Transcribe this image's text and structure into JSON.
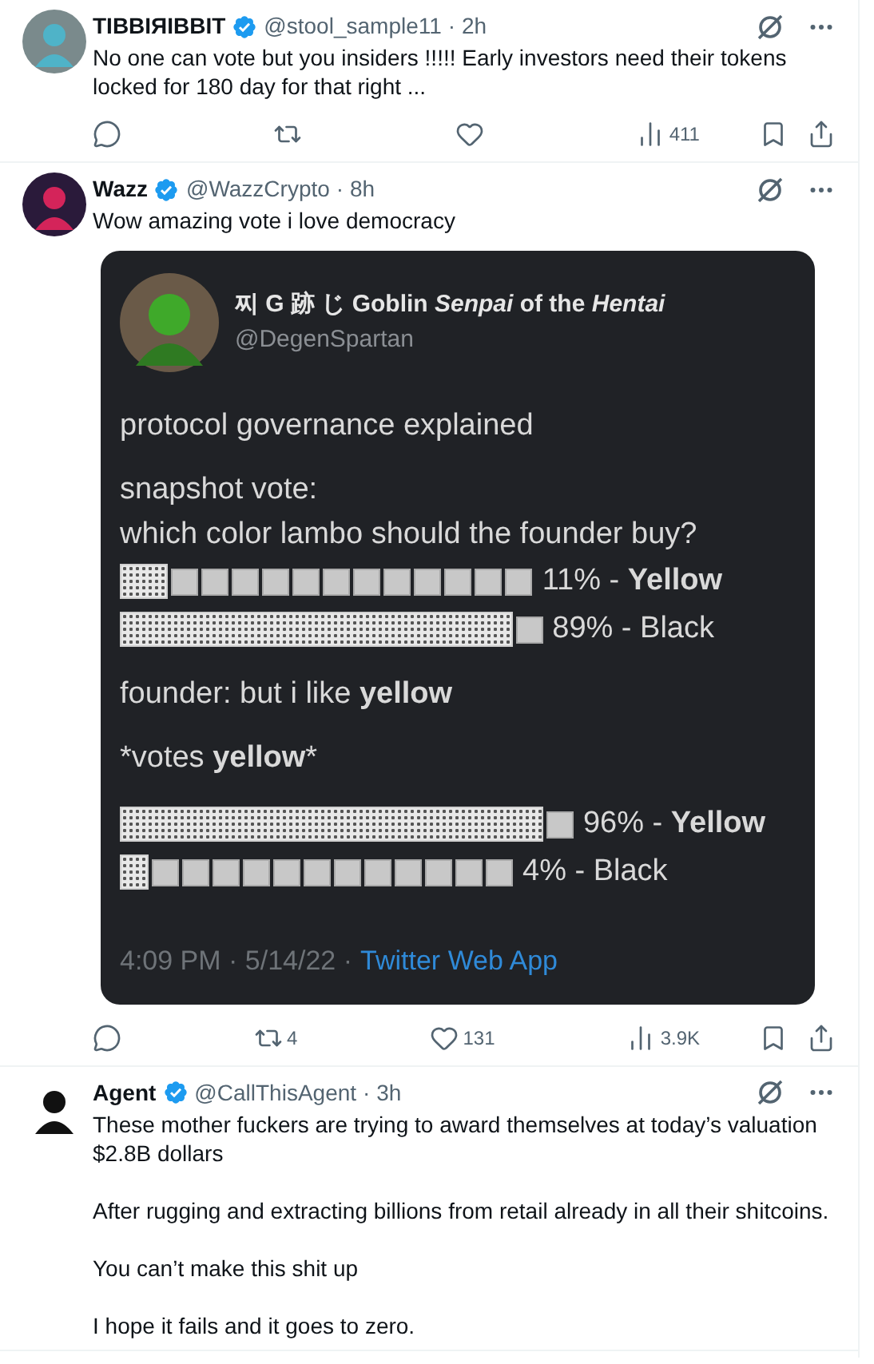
{
  "tweets": [
    {
      "author": {
        "name": "TIBBIЯIBBIT",
        "verified": true,
        "handle": "@stool_sample11",
        "time": "· 2h"
      },
      "body": [
        "No one can vote but you insiders !!!!! Early investors need their tokens locked for 180 day for that right ..."
      ],
      "actions": [
        {
          "kind": "reply"
        },
        {
          "kind": "repost"
        },
        {
          "kind": "like"
        },
        {
          "kind": "views",
          "count": "411"
        },
        {
          "kind": "bookmark"
        },
        {
          "kind": "share"
        }
      ]
    },
    {
      "author": {
        "name": "Wazz",
        "verified": true,
        "handle": "@WazzCrypto",
        "time": "· 8h"
      },
      "body": [
        "Wow amazing vote i love democracy"
      ],
      "quote": {
        "author": {
          "name": "찌 G 跡 じ Goblin *Senpai* of the *Hentai*",
          "handle": "@DegenSpartan"
        },
        "paragraphs": [
          [
            {
              "kind": "text",
              "text": "protocol governance explained"
            }
          ],
          [
            {
              "kind": "text",
              "text": "snapshot vote:"
            },
            {
              "kind": "text",
              "text": "which color lambo should the founder buy?"
            },
            {
              "kind": "poll",
              "level": 0.11,
              "label": "11% - **Yellow**"
            },
            {
              "kind": "poll",
              "level": 0.89,
              "label": "89% - Black"
            }
          ],
          [
            {
              "kind": "text",
              "text": "founder: but i like **yellow**"
            }
          ],
          [
            {
              "kind": "text",
              "text": "*votes **yellow***"
            }
          ],
          [
            {
              "kind": "poll",
              "level": 0.96,
              "label": "96% - **Yellow**"
            },
            {
              "kind": "poll",
              "level": 0.04,
              "label": "4% - Black"
            }
          ]
        ],
        "timestamp": "4:09 PM · 5/14/22 ·",
        "source": "Twitter Web App"
      },
      "actions": [
        {
          "kind": "reply"
        },
        {
          "kind": "repost",
          "count": "4"
        },
        {
          "kind": "like",
          "count": "131"
        },
        {
          "kind": "views",
          "count": "3.9K"
        },
        {
          "kind": "bookmark"
        },
        {
          "kind": "share"
        }
      ]
    },
    {
      "author": {
        "name": "Agent",
        "verified": true,
        "handle": "@CallThisAgent",
        "time": "· 3h"
      },
      "body": [
        "These mother fuckers are trying to award themselves at today’s valuation $2.8B dollars",
        "After rugging and extracting billions from retail already in all their shitcoins.",
        "You can’t make this shit up",
        "I hope it fails and it goes to zero."
      ]
    }
  ]
}
